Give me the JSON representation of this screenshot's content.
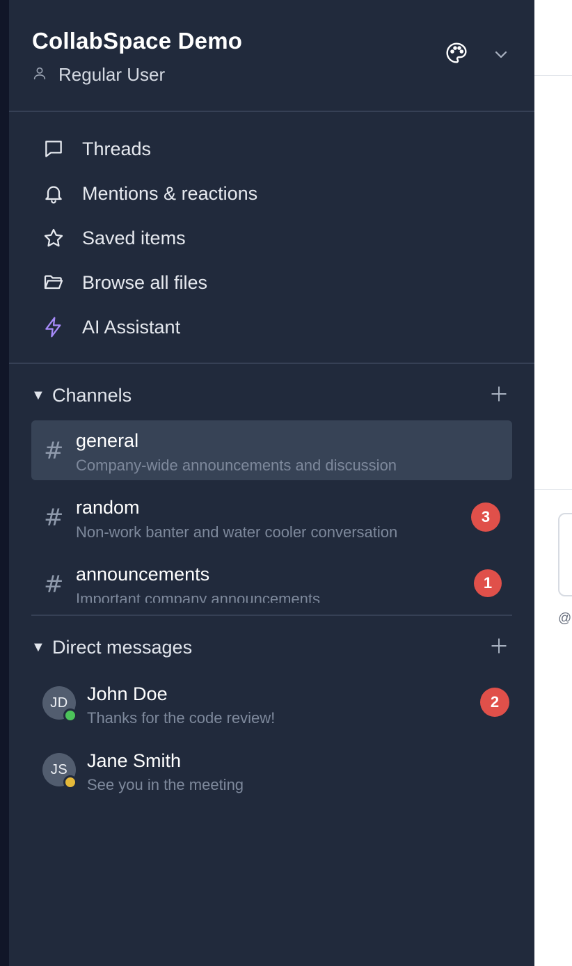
{
  "workspace": {
    "name": "CollabSpace Demo",
    "user_role": "Regular User"
  },
  "nav": [
    {
      "label": "Threads",
      "icon": "message-square-icon"
    },
    {
      "label": "Mentions & reactions",
      "icon": "bell-icon"
    },
    {
      "label": "Saved items",
      "icon": "star-icon"
    },
    {
      "label": "Browse all files",
      "icon": "folder-open-icon"
    },
    {
      "label": "AI Assistant",
      "icon": "zap-icon",
      "color": "#a78bfa"
    }
  ],
  "channels": {
    "title": "Channels",
    "toggle_glyph": "▼",
    "items": [
      {
        "hash": "#",
        "name": "general",
        "description": "Company-wide announcements and discussion",
        "active": true
      },
      {
        "hash": "#",
        "name": "random",
        "description": "Non-work banter and water cooler conversation",
        "unread": "3"
      },
      {
        "hash": "#",
        "name": "announcements",
        "description": "Important company announcements",
        "unread": "1"
      }
    ]
  },
  "direct_messages": {
    "title": "Direct messages",
    "toggle_glyph": "▼",
    "items": [
      {
        "initials": "JD",
        "name": "John Doe",
        "preview": "Thanks for the code review!",
        "status": "online",
        "status_color": "#4cc35a",
        "unread": "2"
      },
      {
        "initials": "JS",
        "name": "Jane Smith",
        "preview": "See you in the meeting",
        "status": "away",
        "status_color": "#e5b93a"
      }
    ]
  },
  "main_partial": {
    "hint": "@u"
  },
  "colors": {
    "sidebar_bg": "#212a3c",
    "active_bg": "#374356",
    "badge": "#e0504a",
    "ai_accent": "#a78bfa"
  }
}
